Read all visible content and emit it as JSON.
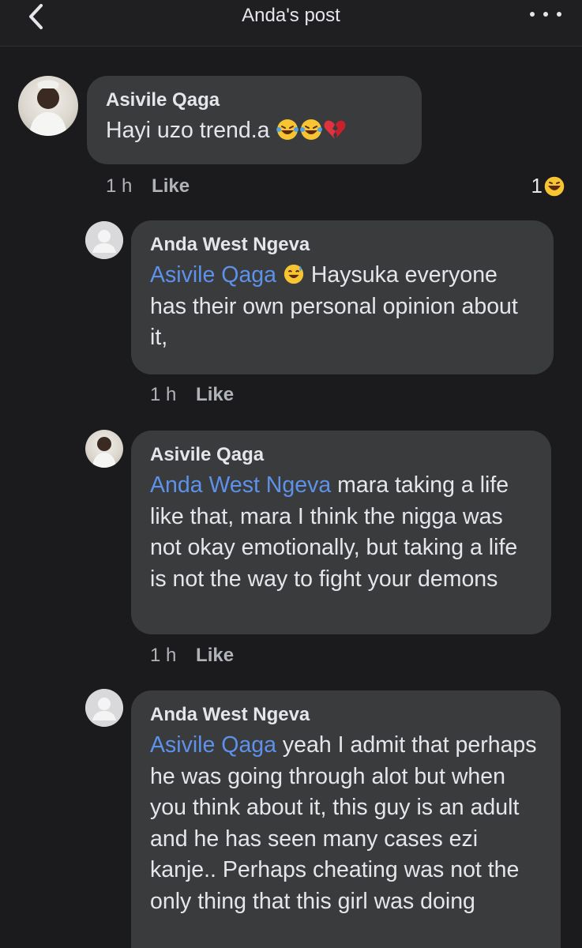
{
  "header": {
    "title": "Anda's post",
    "back_icon": "chevron-left-icon",
    "more_icon": "more-dots-icon"
  },
  "comments": [
    {
      "author": "Asivile Qaga",
      "text": "Hayi uzo trend.a",
      "emojis": [
        "laughing-tears-emoji",
        "laughing-tears-emoji",
        "broken-heart-emoji"
      ],
      "time": "1 h",
      "like_label": "Like",
      "reaction_count": "1",
      "reaction_icon": "laughing-emoji"
    },
    {
      "author": "Anda West Ngeva",
      "mention": "Asivile Qaga",
      "text_line1": "Haysuka",
      "text_rest": "everyone has their own personal opinion about it,",
      "emoji": "sweat-smile-emoji",
      "time": "1 h",
      "like_label": "Like"
    },
    {
      "author": "Asivile Qaga",
      "mention": "Anda West Ngeva",
      "text": " mara taking a life like that, mara I think the nigga was not okay emotionally, but taking a life is not the way to fight your demons",
      "time": "1 h",
      "like_label": "Like"
    },
    {
      "author": "Anda West Ngeva",
      "mention": "Asivile Qaga",
      "text": " yeah I admit that perhaps he was going through alot but when you think about it, this guy is an adult and he has seen many cases ezi kanje.. Perhaps cheating was not the only thing that this girl was doing"
    }
  ],
  "colors": {
    "background": "#1b1b1d",
    "bubble": "#3a3b3c",
    "mention": "#5d91ea",
    "text": "#e4e6eb",
    "meta": "#b0b3b8"
  }
}
